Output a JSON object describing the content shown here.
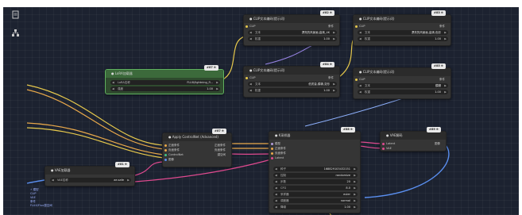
{
  "colors": {
    "canvas": "#1c2230",
    "node": "#353535",
    "green_node": "#2f4a2e",
    "wire_orange": "#e8a84a",
    "wire_yellow": "#e6c84c",
    "wire_pink": "#e04a8f",
    "wire_purple": "#9a86e8",
    "wire_blue": "#5a8ff0",
    "wire_lightblue": "#8fb2ff"
  },
  "toolbar": {
    "icons": [
      "document-icon",
      "hierarchy-icon"
    ]
  },
  "nodes": {
    "lora_loader": {
      "title": "● LoRA加载器",
      "badge": "#87 ⊕",
      "widgets": [
        {
          "label": "LoRA名称",
          "value": "FLUX/lightning_fl..."
        },
        {
          "label": "强度",
          "value": "1.00"
        }
      ]
    },
    "top_a": {
      "title": "● CLIP文本编码(提示词)",
      "badge": "#82 ⊕",
      "rows": [
        "CLIP",
        "条件"
      ],
      "widgets": [
        {
          "label": "文本",
          "value": "漂亮的风景画,高清_4K"
        },
        {
          "label": "权重",
          "value": "1.00"
        }
      ]
    },
    "top_b": {
      "title": "● CLIP文本编码(提示词)",
      "badge": "#83 ⊕",
      "rows": [
        "CLIP",
        "条件"
      ],
      "widgets": [
        {
          "label": "文本",
          "value": "漂亮的风景画,高清,色彩"
        },
        {
          "label": "权重",
          "value": "1.00"
        }
      ]
    },
    "mid_a": {
      "title": "● CLIP文本编码(提示词)",
      "badge": "#84 ⊕",
      "rows": [
        "CLIP",
        "条件"
      ],
      "widgets": [
        {
          "label": "文本",
          "value": "低质量,模糊,变形"
        },
        {
          "label": "权重",
          "value": "1.00"
        }
      ]
    },
    "mid_b": {
      "title": "● CLIP文本编码(提示词)",
      "badge": "#85 ⊕",
      "rows": [
        "CLIP",
        "条件"
      ],
      "widgets": [
        {
          "label": "文本",
          "value": "模糊"
        },
        {
          "label": "权重",
          "value": "1.00"
        }
      ]
    },
    "apply": {
      "title": "● Apply ControlNet (Advanced)",
      "badge": "#87 ⊕",
      "inputs": [
        "正面条件",
        "负面条件",
        "ControlNet",
        "图像"
      ],
      "outputs": [
        "正面条件",
        "负面条件",
        "潜空间"
      ]
    },
    "ksampler": {
      "title": "● K采样器",
      "badge": "#88 ⊕",
      "inputs": [
        "模型",
        "正面条件",
        "负面条件",
        "Latent"
      ],
      "widgets": [
        {
          "label": "种子",
          "value": "168829103432151"
        },
        {
          "label": "控制",
          "value": "randomize"
        },
        {
          "label": "步数",
          "value": "20"
        },
        {
          "label": "CFG",
          "value": "8.0"
        },
        {
          "label": "采样器",
          "value": "euler"
        },
        {
          "label": "调度器",
          "value": "normal"
        },
        {
          "label": "降噪",
          "value": "1.00"
        }
      ]
    },
    "vae_decode": {
      "title": "● VAE解码",
      "badge": "#89 ⊕",
      "inputs": [
        "Latent",
        "VAE"
      ],
      "outputs": [
        "图像"
      ]
    },
    "vae_loader": {
      "title": "● VAE加载器",
      "badge": "#81 ⊕",
      "widgets": [
        {
          "label": "VAE名称",
          "value": "ae.safe"
        }
      ],
      "side": [
        "⚡ 模型",
        "CLIP",
        "VAE",
        "条件",
        "FLUX/Flux潜空间"
      ]
    }
  }
}
